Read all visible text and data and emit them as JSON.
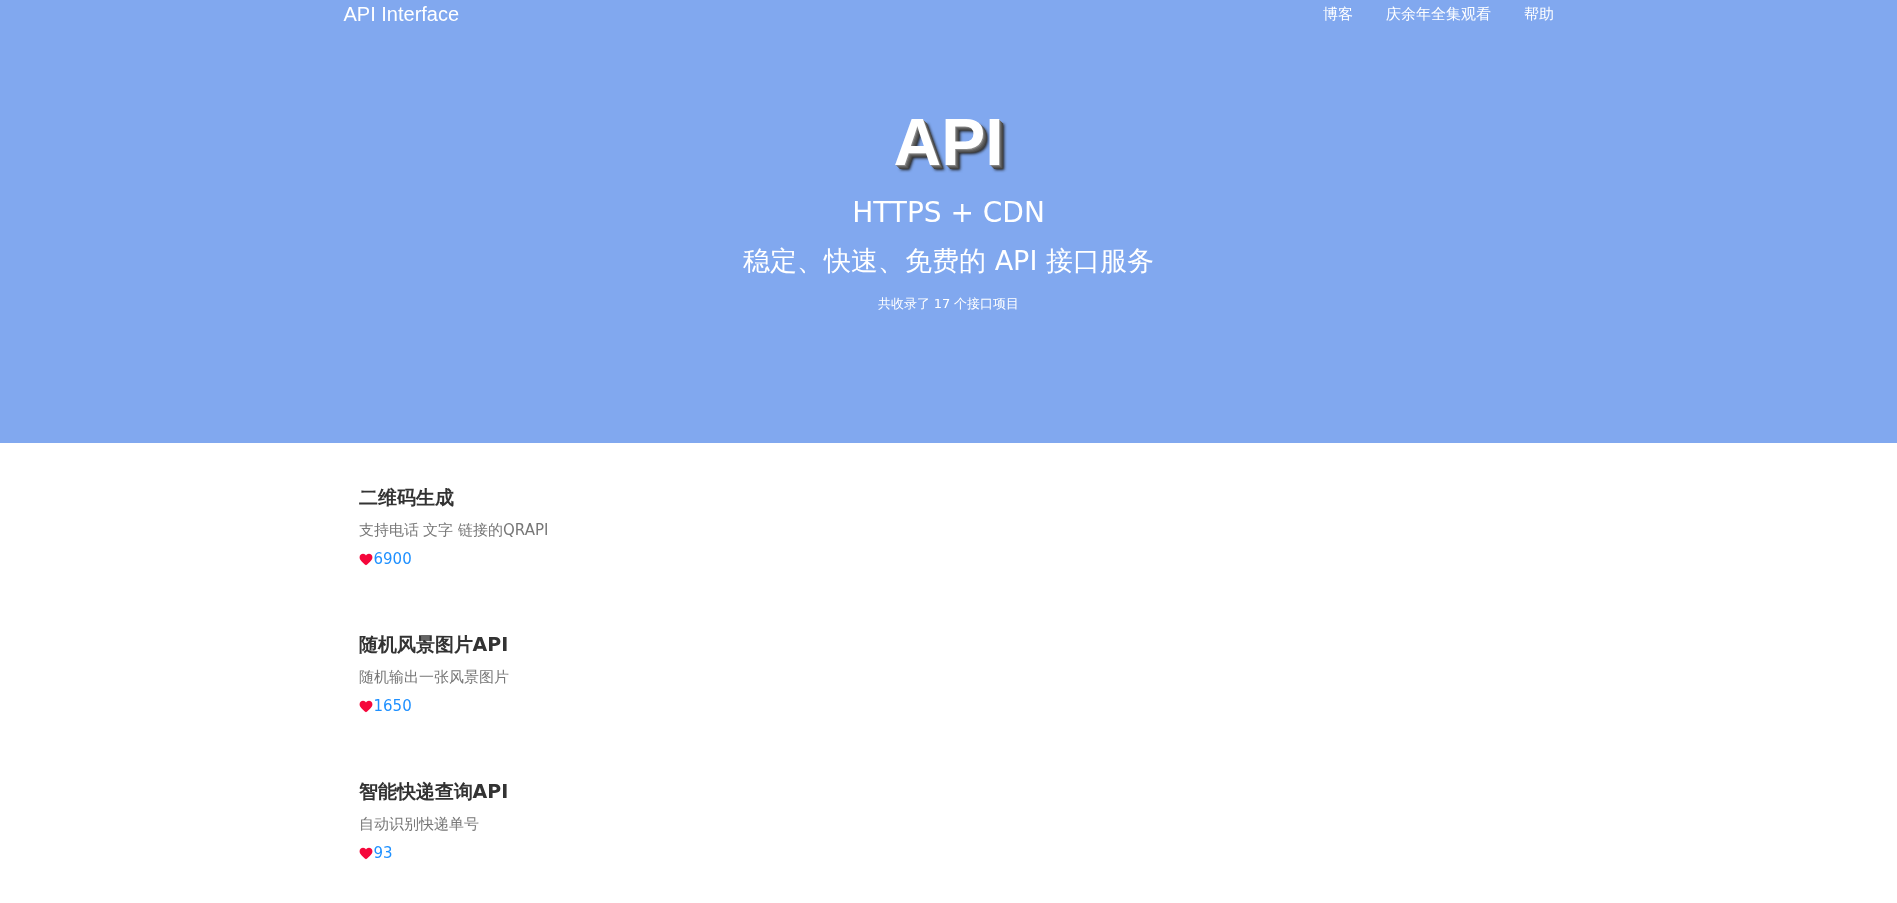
{
  "nav": {
    "brand": "API Interface",
    "links": [
      "博客",
      "庆余年全集观看",
      "帮助"
    ]
  },
  "hero": {
    "logo": "API",
    "subtitle": "HTTPS + CDN",
    "slogan": "稳定、快速、免费的 API 接口服务",
    "count": "共收录了 17 个接口项目"
  },
  "apis": [
    {
      "title": "二维码生成",
      "description": "支持电话 文字 链接的QRAPI",
      "likes": "6900"
    },
    {
      "title": "随机风景图片API",
      "description": "随机输出一张风景图片",
      "likes": "1650"
    },
    {
      "title": "智能快递查询API",
      "description": "自动识别快递单号",
      "likes": "93"
    }
  ]
}
